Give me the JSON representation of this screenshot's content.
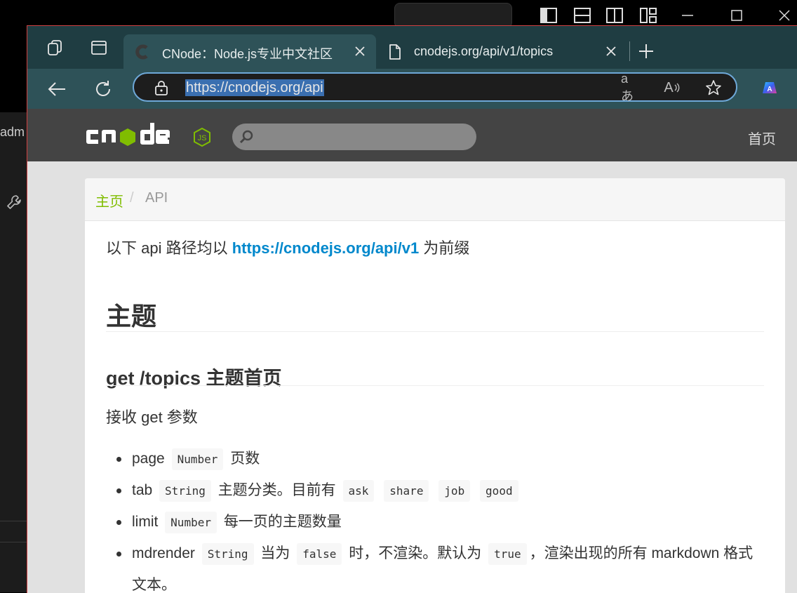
{
  "background": {
    "sidebar_text": "adm"
  },
  "tabs": [
    {
      "title": "CNode：Node.js专业中文社区",
      "active": true
    },
    {
      "title": "cnodejs.org/api/v1/topics",
      "active": false
    }
  ],
  "address": {
    "url": "https://cnodejs.org/api",
    "translate_icon_text": "aあ",
    "read_aloud_icon_text": "A"
  },
  "header": {
    "home_link": "首页"
  },
  "breadcrumb": {
    "home": "主页",
    "separator": "/",
    "current": "API"
  },
  "content": {
    "intro_before": "以下 api 路径均以 ",
    "intro_link": "https://cnodejs.org/api/v1",
    "intro_after": " 为前缀",
    "section_title": "主题",
    "endpoint_title": "get /topics 主题首页",
    "params_intro": "接收 get 参数",
    "params": {
      "page": {
        "name": "page",
        "type": "Number",
        "desc": "页数"
      },
      "tab": {
        "name": "tab",
        "type": "String",
        "desc": "主题分类。目前有",
        "values": [
          "ask",
          "share",
          "job",
          "good"
        ]
      },
      "limit": {
        "name": "limit",
        "type": "Number",
        "desc": "每一页的主题数量"
      },
      "mdrender": {
        "name": "mdrender",
        "type": "String",
        "desc_before": "当为",
        "false_value": "false",
        "desc_middle": "时，不渲染。默认为",
        "true_value": "true",
        "desc_after": "，渲染出现的所有 markdown 格式文本。"
      }
    }
  },
  "colors": {
    "tabbar": "#1f3d42",
    "toolbar": "#2e5258",
    "accent_green": "#80bd01",
    "link_blue": "#08c",
    "header_bg": "#444"
  }
}
